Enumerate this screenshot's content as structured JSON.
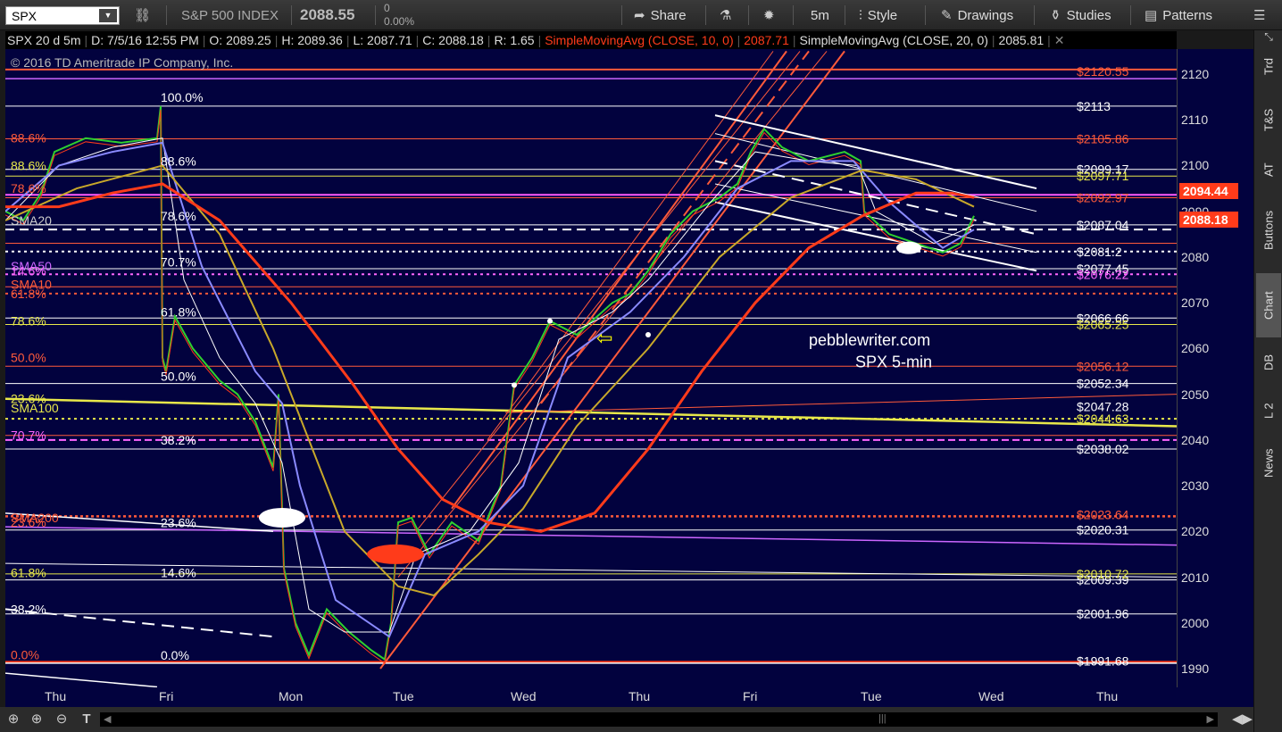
{
  "toolbar": {
    "symbol": "SPX",
    "index_name": "S&P 500 INDEX",
    "last_price": "2088.55",
    "change": "0",
    "change_pct": "0.00%",
    "share": "Share",
    "timeframe": "5m",
    "style": "Style",
    "drawings": "Drawings",
    "studies": "Studies",
    "patterns": "Patterns"
  },
  "status": {
    "title": "SPX 20 d 5m",
    "date": "D: 7/5/16 12:55 PM",
    "open": "O: 2089.25",
    "high": "H: 2089.36",
    "low": "L: 2087.71",
    "close": "C: 2088.18",
    "range": "R: 1.65",
    "sma10": "SimpleMovingAvg (CLOSE, 10, 0)",
    "sma10_val": "2087.71",
    "sma20": "SimpleMovingAvg (CLOSE, 20, 0)",
    "sma20_val": "2085.81"
  },
  "chart": {
    "copyright": "© 2016 TD Ameritrade IP Company, Inc.",
    "watermark_line1": "pebblewriter.com",
    "watermark_line2": "SPX 5-min",
    "y_ticks": [
      "2120",
      "2110",
      "2100",
      "2090",
      "2080",
      "2070",
      "2060",
      "2050",
      "2040",
      "2030",
      "2020",
      "2010",
      "2000",
      "1990"
    ],
    "x_ticks": [
      "Thu",
      "Fri",
      "Mon",
      "Tue",
      "Wed",
      "Thu",
      "Fri",
      "Tue",
      "Wed",
      "Thu"
    ],
    "price_badge_1": "2094.44",
    "price_badge_2": "2088.18",
    "left_labels": [
      {
        "text": "88.6%",
        "color": "#ff5a3a"
      },
      {
        "text": "88.6%",
        "color": "#e8e84a"
      },
      {
        "text": "78.6%",
        "color": "#ff5a3a"
      },
      {
        "text": "SMA20",
        "color": "#cccccc"
      },
      {
        "text": "SMA50",
        "color": "#cc66ff"
      },
      {
        "text": "14.6%",
        "color": "#ff66ff"
      },
      {
        "text": "SMA10",
        "color": "#ff5a3a"
      },
      {
        "text": "61.8%",
        "color": "#ff5a3a"
      },
      {
        "text": "78.6%",
        "color": "#e8e84a"
      },
      {
        "text": "50.0%",
        "color": "#ff5a3a"
      },
      {
        "text": "23.6%",
        "color": "#e8e84a"
      },
      {
        "text": "SMA100",
        "color": "#e8e84a"
      },
      {
        "text": "70.7%",
        "color": "#ff66ff"
      },
      {
        "text": "SMA200",
        "color": "#ff5a3a"
      },
      {
        "text": "23.6%",
        "color": "#ff5a3a"
      },
      {
        "text": "61.8%",
        "color": "#e8e84a"
      },
      {
        "text": "38.2%",
        "color": "#ffffff"
      },
      {
        "text": "0.0%",
        "color": "#ff5a3a"
      }
    ],
    "fib_labels": [
      "100.0%",
      "88.6%",
      "78.6%",
      "70.7%",
      "61.8%",
      "50.0%",
      "38.2%",
      "23.6%",
      "14.6%",
      "0.0%"
    ],
    "right_labels": [
      {
        "text": "$2120.55",
        "color": "#ff5a3a"
      },
      {
        "text": "$2113",
        "color": "#ffffff"
      },
      {
        "text": "$2105.86",
        "color": "#ff5a3a"
      },
      {
        "text": "$2099.17",
        "color": "#ffffff"
      },
      {
        "text": "$2097.71",
        "color": "#e8e84a"
      },
      {
        "text": "$2092.97",
        "color": "#ff5a3a"
      },
      {
        "text": "$2087.04",
        "color": "#ffffff"
      },
      {
        "text": "$2081.2",
        "color": "#ffffff"
      },
      {
        "text": "$2077.45",
        "color": "#ffffff"
      },
      {
        "text": "$2076.22",
        "color": "#ff66ff"
      },
      {
        "text": "$2066.66",
        "color": "#ffffff"
      },
      {
        "text": "$2065.25",
        "color": "#e8e84a"
      },
      {
        "text": "$2056.12",
        "color": "#ff5a3a"
      },
      {
        "text": "$2052.34",
        "color": "#ffffff"
      },
      {
        "text": "$2047.28",
        "color": "#ffffff"
      },
      {
        "text": "$2044.63",
        "color": "#e8e84a"
      },
      {
        "text": "$2038.02",
        "color": "#ffffff"
      },
      {
        "text": "$2023.64",
        "color": "#ff5a3a"
      },
      {
        "text": "$2020.31",
        "color": "#ffffff"
      },
      {
        "text": "$2009.39",
        "color": "#ffffff"
      },
      {
        "text": "$2010.72",
        "color": "#e8e84a"
      },
      {
        "text": "$2001.96",
        "color": "#ffffff"
      },
      {
        "text": "$1991.68",
        "color": "#ffffff"
      }
    ]
  },
  "side_tabs": [
    "Trd",
    "T&S",
    "AT",
    "Buttons",
    "Chart",
    "DB",
    "L 2",
    "News"
  ],
  "colors": {
    "bg": "#02023e",
    "red": "#ff3b1a",
    "orange": "#ff6a2a",
    "yellow": "#e8e84a",
    "white": "#ffffff",
    "purple": "#cc66ff",
    "blue": "#8a8aff"
  }
}
